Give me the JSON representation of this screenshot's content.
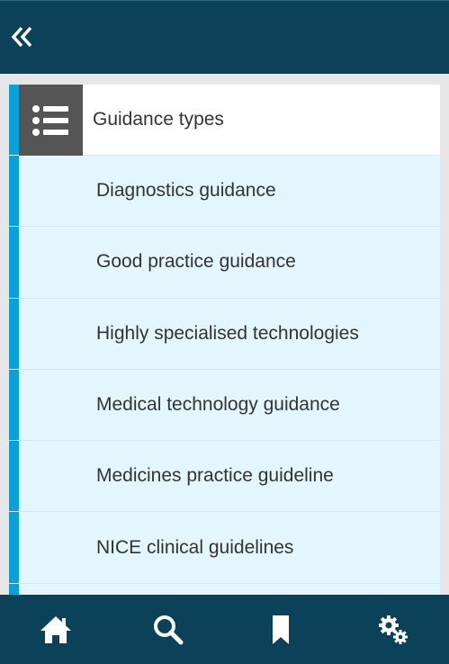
{
  "header": {
    "back_icon": "double-chevron-left-icon"
  },
  "list": {
    "title": "Guidance types",
    "title_icon": "list-icon",
    "items": [
      {
        "label": "Diagnostics guidance"
      },
      {
        "label": "Good practice guidance"
      },
      {
        "label": "Highly specialised technologies"
      },
      {
        "label": "Medical technology guidance"
      },
      {
        "label": "Medicines practice guideline"
      },
      {
        "label": "NICE clinical guidelines"
      },
      {
        "label": ""
      }
    ]
  },
  "bottom_nav": [
    {
      "icon": "home-icon"
    },
    {
      "icon": "search-icon"
    },
    {
      "icon": "bookmark-icon"
    },
    {
      "icon": "settings-icon"
    }
  ],
  "colors": {
    "bar": "#0b4259",
    "accent": "#0aa1d8",
    "row_bg": "#e3f5fd",
    "icon_box": "#555555"
  }
}
